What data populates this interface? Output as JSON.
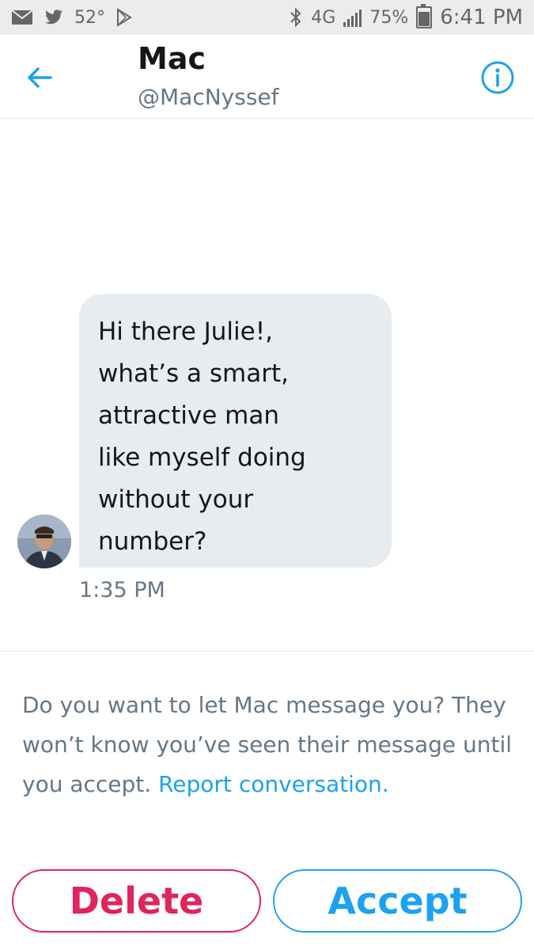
{
  "status_bar": {
    "icons_left": [
      "mail-icon",
      "twitter-bird-icon",
      "play-store-icon"
    ],
    "temperature": "52°",
    "icons_right": [
      "bluetooth-icon",
      "network-4g-icon",
      "signal-icon",
      "battery-icon"
    ],
    "network": "4G",
    "battery_percent": "75%",
    "battery_level": 0.75,
    "time": "6:41 PM"
  },
  "header": {
    "back_icon": "arrow-left-icon",
    "name": "Mac",
    "handle": "@MacNyssef",
    "info_icon": "info-circle-icon"
  },
  "conversation": {
    "message": "Hi there Julie!,\nwhat’s a smart,\nattractive man\nlike myself doing\nwithout your\nnumber?",
    "time": "1:35 PM"
  },
  "request": {
    "prompt": "Do you want to let Mac message you? They won’t know you’ve seen their message until you accept.",
    "report_link": "Report conversation."
  },
  "actions": {
    "delete_label": "Delete",
    "accept_label": "Accept"
  },
  "colors": {
    "accent": "#1da1f2",
    "danger": "#e0245e",
    "bubble": "#e6ecf0",
    "secondary_text": "#657786"
  }
}
